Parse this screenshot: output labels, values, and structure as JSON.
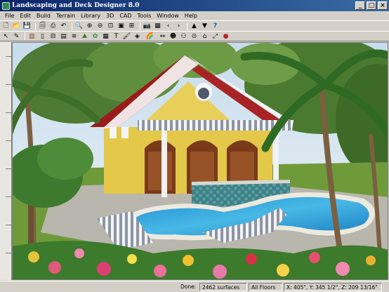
{
  "window": {
    "title": "Landscaping and Deck Designer 8.0",
    "minimize_glyph": "_",
    "maximize_glyph": "□",
    "close_glyph": "×"
  },
  "menu": [
    "File",
    "Edit",
    "Build",
    "Terrain",
    "Library",
    "3D",
    "CAD",
    "Tools",
    "Window",
    "Help"
  ],
  "toolbar_row1": [
    {
      "icon": "new-file-icon",
      "glyph": "🗋"
    },
    {
      "icon": "open-folder-icon",
      "glyph": "📂"
    },
    {
      "icon": "save-icon",
      "glyph": "💾"
    },
    {
      "icon": "print-preview-icon",
      "glyph": "🗐"
    },
    {
      "icon": "print-icon",
      "glyph": "⎙"
    },
    {
      "icon": "undo-icon",
      "glyph": "↶"
    },
    {
      "icon": "zoom-icon",
      "glyph": "🔍"
    },
    {
      "icon": "zoom-in-icon",
      "glyph": "⊕"
    },
    {
      "icon": "zoom-out-icon",
      "glyph": "⊖"
    },
    {
      "icon": "zoom-fit-icon",
      "glyph": "⊡"
    },
    {
      "icon": "fill-window-icon",
      "glyph": "▣"
    },
    {
      "icon": "pan-window-icon",
      "glyph": "⊞"
    },
    {
      "icon": "camera-icon",
      "glyph": "📷"
    },
    {
      "icon": "elevation-icon",
      "glyph": "▦"
    },
    {
      "icon": "previous-icon",
      "glyph": "‹"
    },
    {
      "icon": "next-icon",
      "glyph": "›"
    },
    {
      "icon": "floor-up-icon",
      "glyph": "▲"
    },
    {
      "icon": "floor-down-icon",
      "glyph": "▼"
    },
    {
      "icon": "help-icon",
      "glyph": "?"
    }
  ],
  "toolbar_row2": [
    {
      "icon": "select-arrow-icon",
      "glyph": "↖"
    },
    {
      "icon": "edit-icon",
      "glyph": "✎"
    },
    {
      "icon": "wall-icon",
      "glyph": "▥"
    },
    {
      "icon": "door-icon",
      "glyph": "▯"
    },
    {
      "icon": "window-tool-icon",
      "glyph": "⊟"
    },
    {
      "icon": "cabinet-icon",
      "glyph": "▤"
    },
    {
      "icon": "stairs-icon",
      "glyph": "≡"
    },
    {
      "icon": "terrain-icon",
      "glyph": "⛰"
    },
    {
      "icon": "plant-icon",
      "glyph": "✿"
    },
    {
      "icon": "library-icon",
      "glyph": "▦"
    },
    {
      "icon": "text-icon",
      "glyph": "T"
    },
    {
      "icon": "paint-icon",
      "glyph": "🖌"
    },
    {
      "icon": "material-icon",
      "glyph": "◈"
    },
    {
      "icon": "rainbow-icon",
      "glyph": "🌈"
    },
    {
      "icon": "dimension-icon",
      "glyph": "↔"
    },
    {
      "icon": "person-icon",
      "glyph": "☻"
    },
    {
      "icon": "group-icon",
      "glyph": "⚇"
    },
    {
      "icon": "camera-tool-icon",
      "glyph": "⊙"
    },
    {
      "icon": "home-icon",
      "glyph": "⌂"
    },
    {
      "icon": "transform-icon",
      "glyph": "⤢"
    },
    {
      "icon": "color-icon",
      "glyph": "●"
    }
  ],
  "status": {
    "done": "Done:",
    "surfaces": "2462 surfaces",
    "floors": "All Floors",
    "coords": "X: 405\", Y: 345 1/2\", Z: 209 13/16\""
  },
  "colors": {
    "title_start": "#0a246a",
    "title_end": "#3a6ea5",
    "chrome": "#d4d0c8",
    "roof": "#9b1b1b",
    "walls": "#e3c84a",
    "pool_water": "#2fa0d8",
    "lawn": "#6f9a3a"
  }
}
